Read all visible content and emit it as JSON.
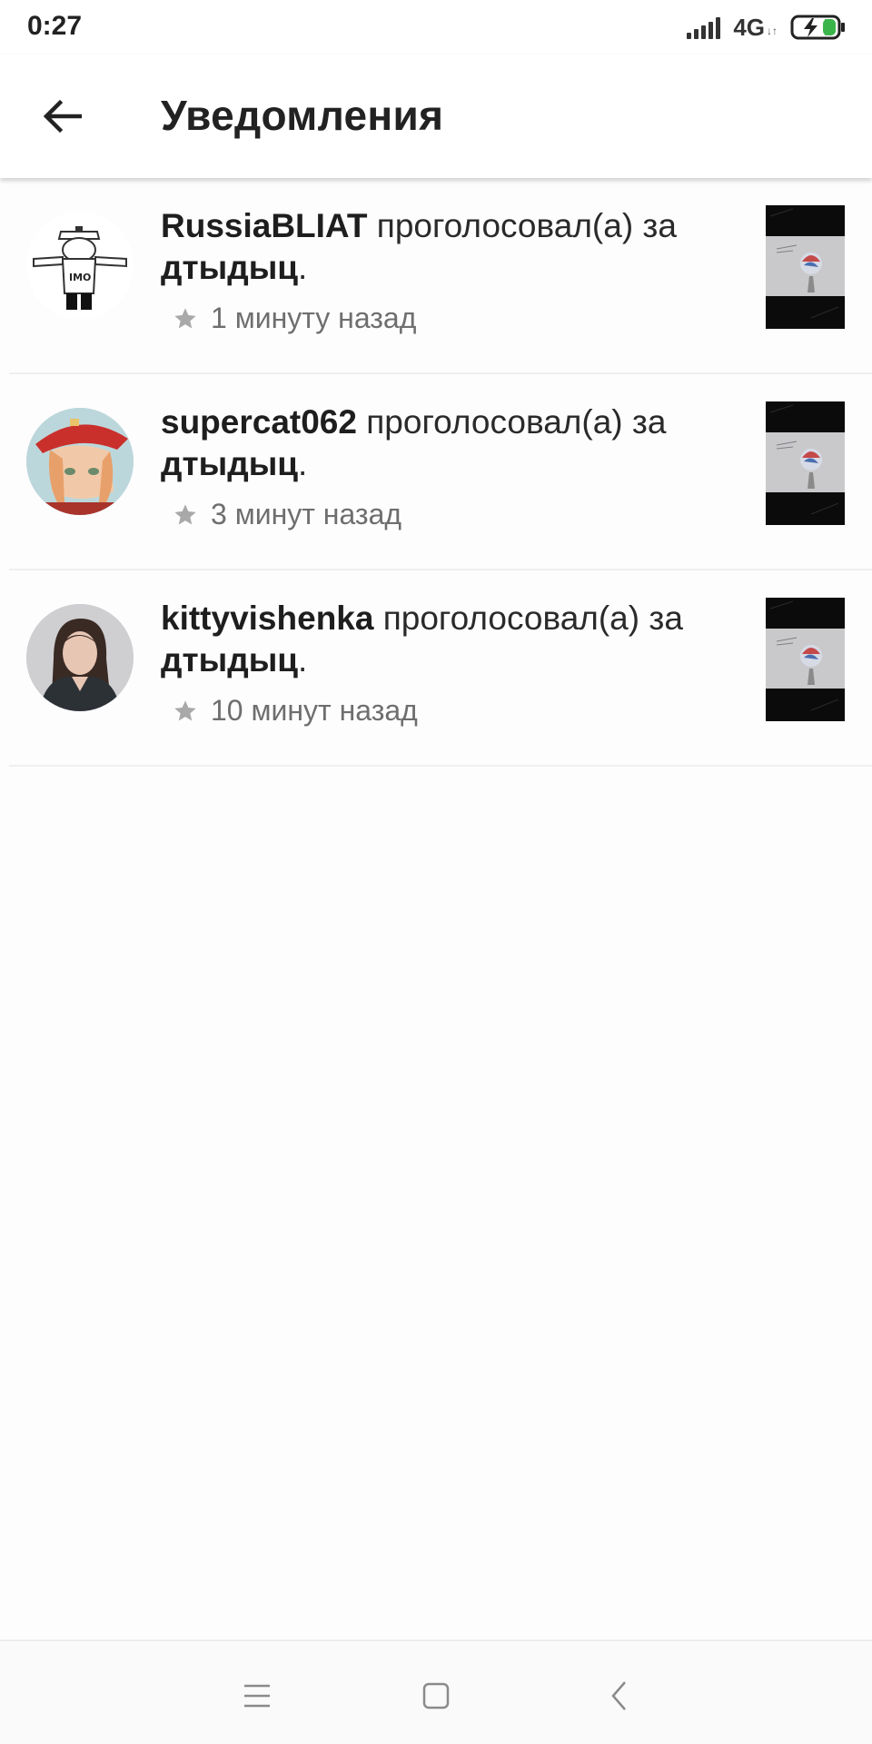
{
  "status_bar": {
    "time": "0:27",
    "network": "4G",
    "icons": [
      "signal-icon",
      "battery-charging-icon"
    ],
    "battery_accent": "#3bb54a"
  },
  "app_bar": {
    "title": "Уведомления",
    "back_icon": "arrow-left-icon"
  },
  "notifications": [
    {
      "user": "RussiaBLIAT",
      "action": "проголосовал(а) за",
      "post": "дтыдыц",
      "time": "1 минуту назад",
      "avatar_shirt_text": "IMO"
    },
    {
      "user": "supercat062",
      "action": "проголосовал(а) за",
      "post": "дтыдыц",
      "time": "3 минут назад"
    },
    {
      "user": "kittyvishenka",
      "action": "проголосовал(а) за",
      "post": "дтыдыц",
      "time": "10 минут назад"
    }
  ],
  "nav_bar": {
    "icons": [
      "menu-icon",
      "home-square-icon",
      "back-chevron-icon"
    ]
  }
}
